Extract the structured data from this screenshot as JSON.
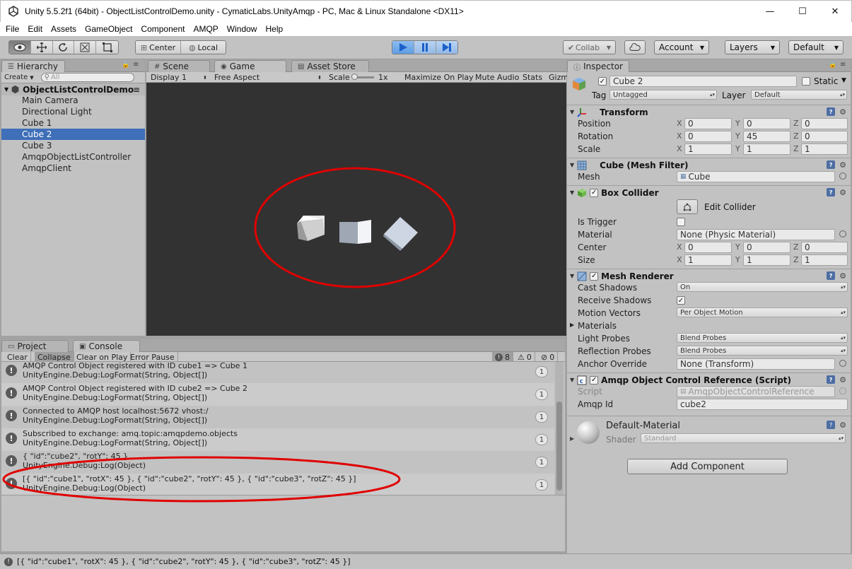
{
  "window": {
    "title": "Unity 5.5.2f1 (64bit) - ObjectListControlDemo.unity - CymaticLabs.UnityAmqp - PC, Mac & Linux Standalone <DX11>",
    "minimize": "—",
    "maximize": "☐",
    "close": "✕"
  },
  "menu": [
    "File",
    "Edit",
    "Assets",
    "GameObject",
    "Component",
    "AMQP",
    "Window",
    "Help"
  ],
  "toolbar": {
    "center": "Center",
    "local": "Local",
    "collab": "Collab",
    "account": "Account",
    "layers": "Layers",
    "layout": "Default"
  },
  "hierarchy": {
    "tab": "Hierarchy",
    "create": "Create",
    "search_placeholder": "All",
    "root": "ObjectListControlDemo",
    "items": [
      "Main Camera",
      "Directional Light",
      "Cube 1",
      "Cube 2",
      "Cube 3",
      "AmqpObjectListController",
      "AmqpClient"
    ],
    "selected": "Cube 2"
  },
  "game": {
    "tabs": {
      "scene": "Scene",
      "game": "Game",
      "asset_store": "Asset Store"
    },
    "display": "Display 1",
    "aspect": "Free Aspect",
    "scale_label": "Scale",
    "scale_value": "1x",
    "maximize": "Maximize On Play",
    "mute": "Mute Audio",
    "stats": "Stats",
    "gizmos": "Gizm",
    "highlight_color": "#e00000"
  },
  "console": {
    "tabs": {
      "project": "Project",
      "console": "Console"
    },
    "buttons": {
      "clear": "Clear",
      "collapse": "Collapse",
      "clear_on_play": "Clear on Play",
      "error_pause": "Error Pause"
    },
    "counts": {
      "info": "8",
      "warn": "0",
      "error": "0"
    },
    "entries": [
      {
        "line1": "AMQP Control Object registered with ID cube1 => Cube 1",
        "line2": "UnityEngine.Debug:LogFormat(String, Object[])",
        "count": "1"
      },
      {
        "line1": "AMQP Control Object registered with ID cube2 => Cube 2",
        "line2": "UnityEngine.Debug:LogFormat(String, Object[])",
        "count": "1"
      },
      {
        "line1": "Connected to AMQP host localhost:5672 vhost:/",
        "line2": "UnityEngine.Debug:LogFormat(String, Object[])",
        "count": "1"
      },
      {
        "line1": "Subscribed to exchange: amq.topic:amqpdemo.objects",
        "line2": "UnityEngine.Debug:LogFormat(String, Object[])",
        "count": "1"
      },
      {
        "line1": "{ \"id\":\"cube2\", \"rotY\": 45 }",
        "line2": "UnityEngine.Debug:Log(Object)",
        "count": "1"
      },
      {
        "line1": "[{ \"id\":\"cube1\", \"rotX\": 45 }, { \"id\":\"cube2\", \"rotY\": 45 }, { \"id\":\"cube3\", \"rotZ\": 45 }]",
        "line2": "UnityEngine.Debug:Log(Object)",
        "count": "1"
      }
    ]
  },
  "statusbar": {
    "text": "[{ \"id\":\"cube1\", \"rotX\": 45 }, { \"id\":\"cube2\", \"rotY\": 45 }, { \"id\":\"cube3\", \"rotZ\": 45 }]"
  },
  "inspector": {
    "tab": "Inspector",
    "object_name": "Cube 2",
    "static": "Static",
    "tag_label": "Tag",
    "tag": "Untagged",
    "layer_label": "Layer",
    "layer": "Default",
    "transform": {
      "title": "Transform",
      "position": {
        "label": "Position",
        "x": "0",
        "y": "0",
        "z": "0"
      },
      "rotation": {
        "label": "Rotation",
        "x": "0",
        "y": "45",
        "z": "0"
      },
      "scale": {
        "label": "Scale",
        "x": "1",
        "y": "1",
        "z": "1"
      }
    },
    "axes": {
      "x": "X",
      "y": "Y",
      "z": "Z"
    },
    "mesh_filter": {
      "title": "Cube (Mesh Filter)",
      "mesh_label": "Mesh",
      "mesh": "Cube"
    },
    "box_collider": {
      "title": "Box Collider",
      "edit": "Edit Collider",
      "is_trigger": "Is Trigger",
      "material_label": "Material",
      "material": "None (Physic Material)",
      "center": {
        "label": "Center",
        "x": "0",
        "y": "0",
        "z": "0"
      },
      "size": {
        "label": "Size",
        "x": "1",
        "y": "1",
        "z": "1"
      }
    },
    "mesh_renderer": {
      "title": "Mesh Renderer",
      "cast_shadows_label": "Cast Shadows",
      "cast_shadows": "On",
      "receive_shadows": "Receive Shadows",
      "motion_vectors_label": "Motion Vectors",
      "motion_vectors": "Per Object Motion",
      "materials": "Materials",
      "light_probes_label": "Light Probes",
      "light_probes": "Blend Probes",
      "reflection_probes_label": "Reflection Probes",
      "reflection_probes": "Blend Probes",
      "anchor_override_label": "Anchor Override",
      "anchor_override": "None (Transform)"
    },
    "amqp_script": {
      "title": "Amqp Object Control Reference (Script)",
      "script_label": "Script",
      "script": "AmqpObjectControlReference",
      "amqp_id_label": "Amqp Id",
      "amqp_id": "cube2"
    },
    "material": {
      "name": "Default-Material",
      "shader_label": "Shader",
      "shader": "Standard"
    },
    "add_component": "Add Component"
  }
}
